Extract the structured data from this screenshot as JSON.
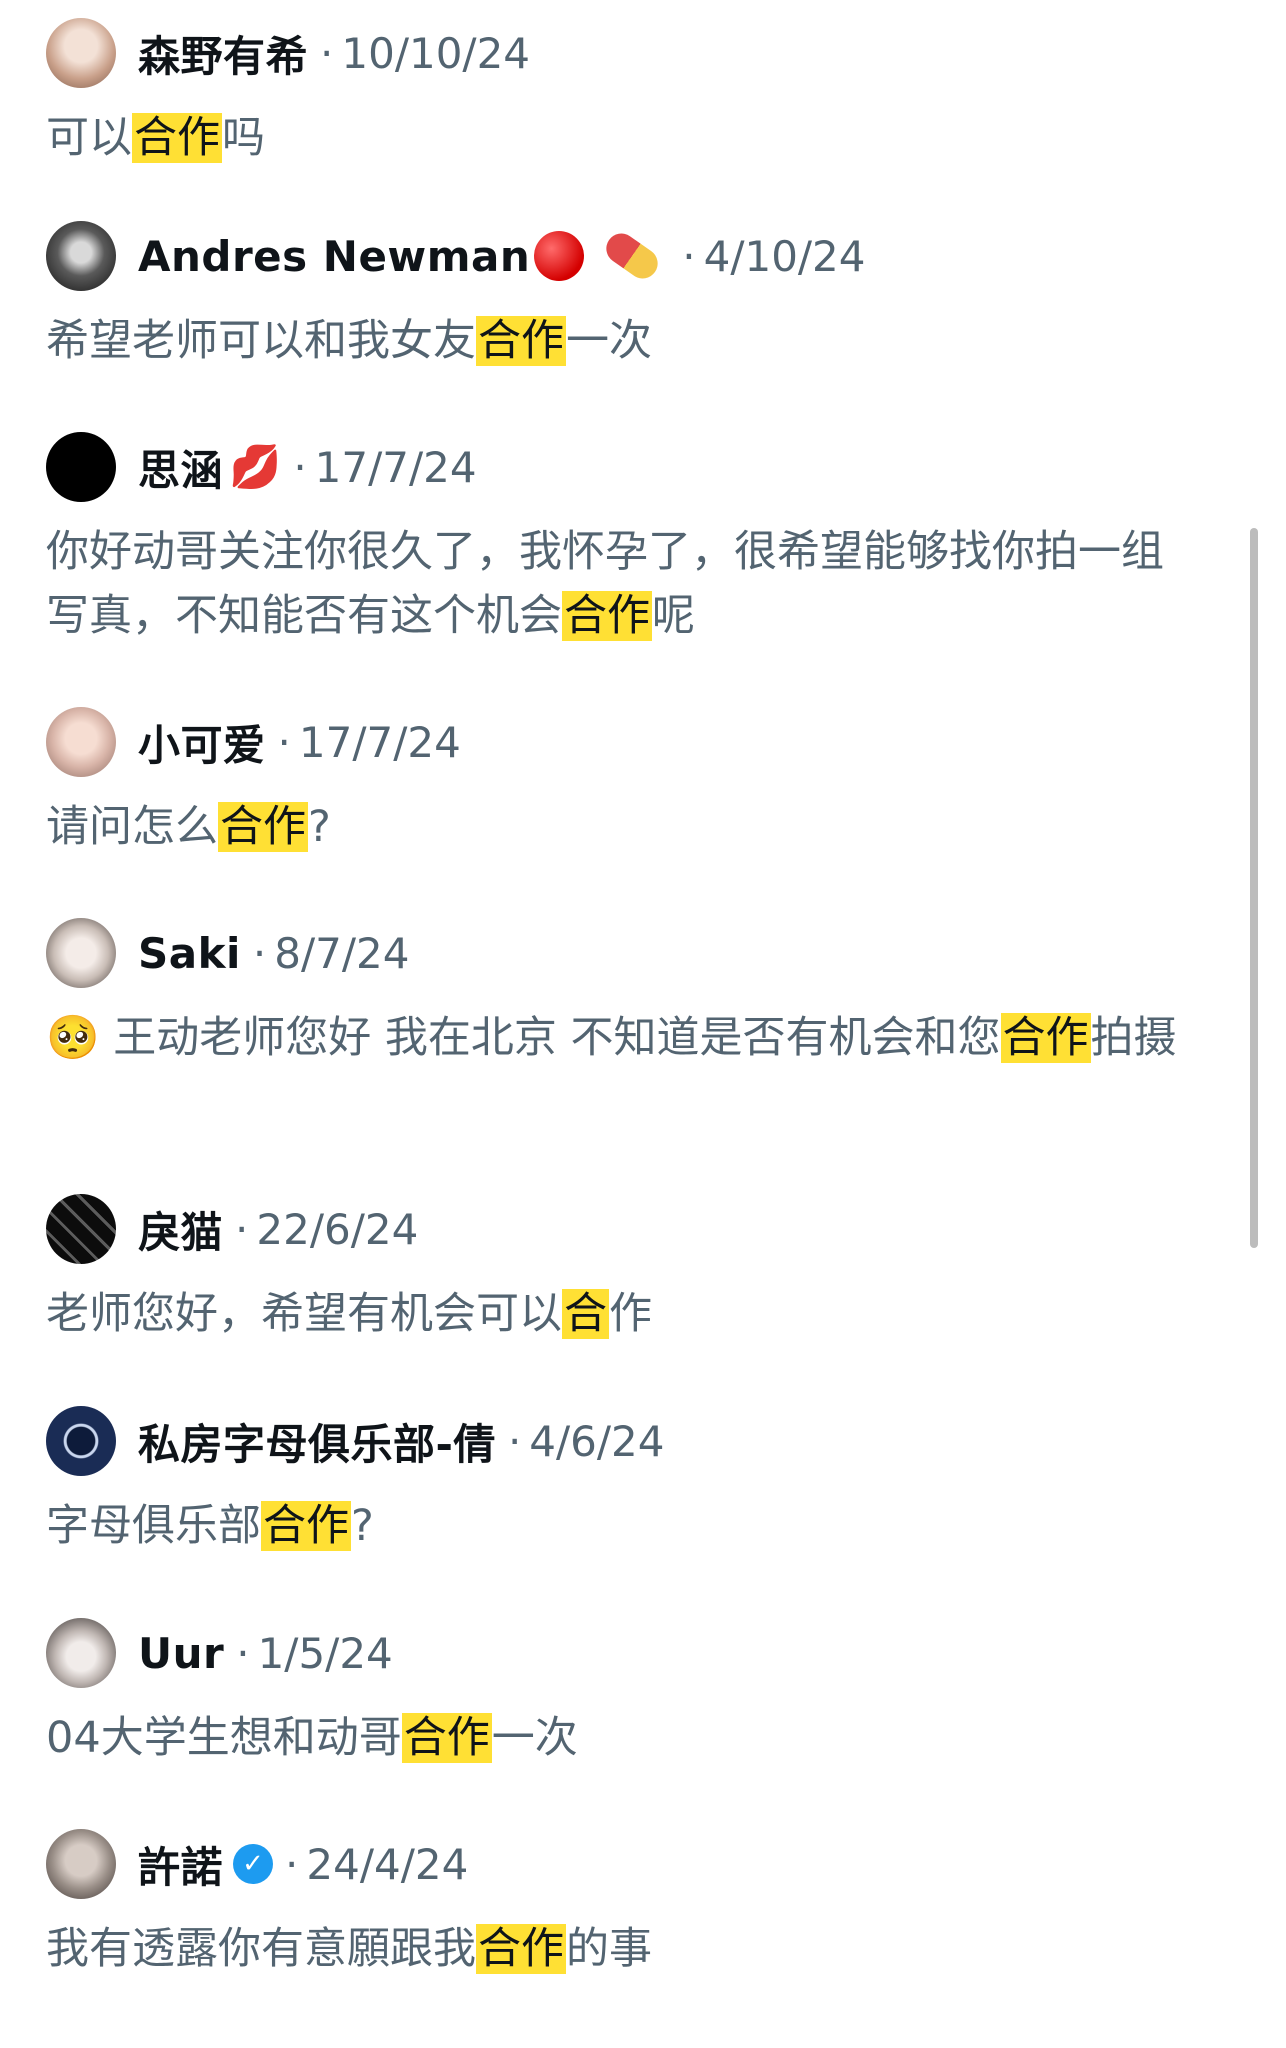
{
  "comments": [
    {
      "name": "森野有希",
      "date": "10/10/24",
      "text_before": "可以",
      "highlight": "合作",
      "text_after": "吗",
      "avatar_icon": "portrait-avatar",
      "avatar_color": "#c9a08a"
    },
    {
      "name": "Andres Newman",
      "emoji": "🔴 💊",
      "date": "4/10/24",
      "text_before": "希望老师可以和我女友",
      "highlight": "合作",
      "text_after": "一次",
      "avatar_icon": "portrait-avatar",
      "avatar_color": "#2a2a2a"
    },
    {
      "name": "思涵",
      "emoji": "💋",
      "date": "17/7/24",
      "text_before": "你好动哥关注你很久了，我怀孕了，很希望能够找你拍一组写真，不知能否有这个机会",
      "highlight": "合作",
      "text_after": "呢",
      "avatar_icon": "black-circle-avatar",
      "avatar_color": "#000000"
    },
    {
      "name": "小可爱",
      "date": "17/7/24",
      "text_before": "请问怎么",
      "highlight": "合作",
      "text_after": "?",
      "avatar_icon": "portrait-avatar",
      "avatar_color": "#d8b4a8"
    },
    {
      "name": "Saki",
      "date": "8/7/24",
      "text_before": "🥺 王动老师您好 我在北京 不知道是否有机会和您",
      "highlight": "合作",
      "text_after": "拍摄",
      "avatar_icon": "portrait-avatar",
      "avatar_color": "#e0d8d4"
    },
    {
      "name": "戾猫",
      "date": "22/6/24",
      "text_before": "老师您好，希望有机会可以",
      "highlight": "合",
      "text_after": "作",
      "avatar_icon": "dark-pattern-avatar",
      "avatar_color": "#1a1a1a"
    },
    {
      "name": "私房字母俱乐部-倩",
      "date": "4/6/24",
      "text_before": "字母俱乐部",
      "highlight": "合作",
      "text_after": "?",
      "avatar_icon": "ring-avatar",
      "avatar_color": "#0d1b3a"
    },
    {
      "name": "Uur",
      "date": "1/5/24",
      "text_before": "04大学生想和动哥",
      "highlight": "合作",
      "text_after": "一次",
      "avatar_icon": "portrait-avatar",
      "avatar_color": "#cfc8c4"
    },
    {
      "name": "許諾",
      "verified": "✓",
      "date": "24/4/24",
      "text_before": "我有透露你有意願跟我",
      "highlight": "合作",
      "text_after": "的事",
      "avatar_icon": "portrait-avatar",
      "avatar_color": "#9a8f88"
    }
  ],
  "separator": "·"
}
